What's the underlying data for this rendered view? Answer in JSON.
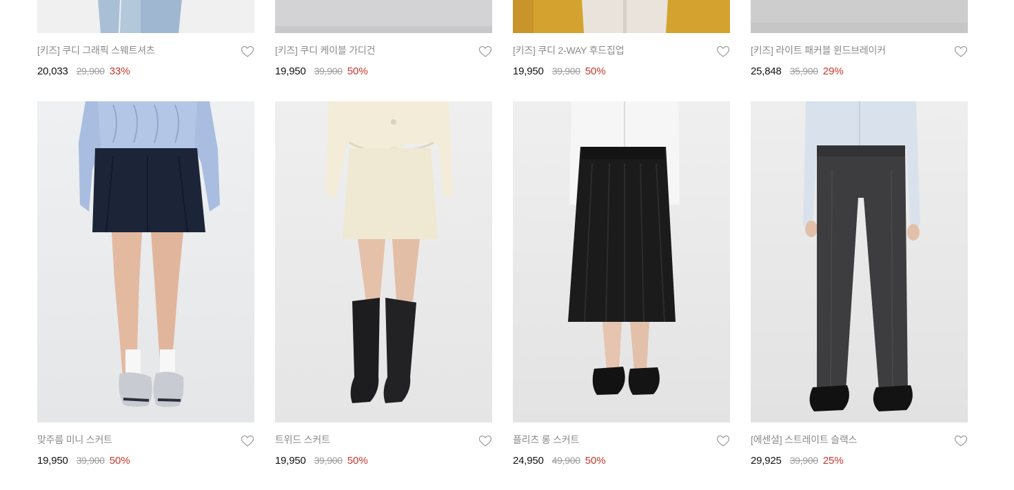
{
  "products_top": [
    {
      "name": "[키즈] 쿠디 그래픽 스웨트셔츠",
      "price": "20,033",
      "original_price": "29,900",
      "discount": "33%"
    },
    {
      "name": "[키즈] 쿠디 케이블 가디건",
      "price": "19,950",
      "original_price": "39,900",
      "discount": "50%"
    },
    {
      "name": "[키즈] 쿠디 2-WAY 후드집업",
      "price": "19,950",
      "original_price": "39,900",
      "discount": "50%"
    },
    {
      "name": "[키즈] 라이트 패커블 윈드브레이커",
      "price": "25,848",
      "original_price": "35,900",
      "discount": "29%"
    }
  ],
  "products_bottom": [
    {
      "name": "맞주름 미니 스커트",
      "price": "19,950",
      "original_price": "39,900",
      "discount": "50%"
    },
    {
      "name": "트위드 스커트",
      "price": "19,950",
      "original_price": "39,900",
      "discount": "50%"
    },
    {
      "name": "플리츠 롱 스커트",
      "price": "24,950",
      "original_price": "49,900",
      "discount": "50%"
    },
    {
      "name": "[에센셜] 스트레이트 슬랙스",
      "price": "29,925",
      "original_price": "39,900",
      "discount": "25%"
    }
  ],
  "colors": {
    "discount": "#c8342c",
    "name": "#8a8a8a",
    "price": "#111111",
    "original_price": "#9a9a9a"
  },
  "icons": {
    "wishlist": "heart-outline-icon"
  }
}
